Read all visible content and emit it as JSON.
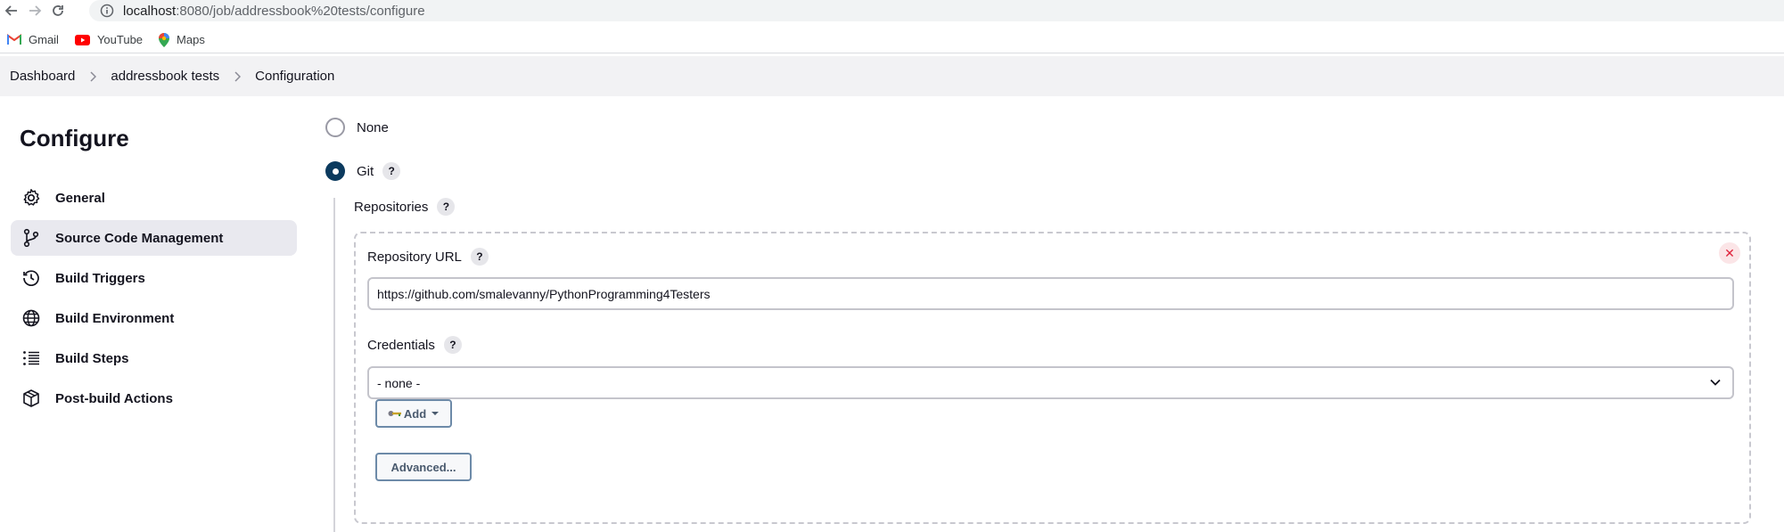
{
  "browser": {
    "url_host": "localhost",
    "url_path": ":8080/job/addressbook%20tests/configure",
    "bookmarks": [
      {
        "label": "Gmail",
        "icon": "gmail-icon"
      },
      {
        "label": "YouTube",
        "icon": "youtube-icon"
      },
      {
        "label": "Maps",
        "icon": "maps-icon"
      }
    ]
  },
  "breadcrumbs": [
    "Dashboard",
    "addressbook tests",
    "Configuration"
  ],
  "sidebar": {
    "title": "Configure",
    "items": [
      {
        "label": "General",
        "icon": "gear-icon"
      },
      {
        "label": "Source Code Management",
        "icon": "branch-icon",
        "active": true
      },
      {
        "label": "Build Triggers",
        "icon": "clock-icon"
      },
      {
        "label": "Build Environment",
        "icon": "globe-icon"
      },
      {
        "label": "Build Steps",
        "icon": "list-icon"
      },
      {
        "label": "Post-build Actions",
        "icon": "package-icon"
      }
    ]
  },
  "scm": {
    "options": [
      {
        "label": "None",
        "checked": false
      },
      {
        "label": "Git",
        "checked": true
      }
    ],
    "repositories_label": "Repositories",
    "repo_url_label": "Repository URL",
    "repo_url_value": "https://github.com/smalevanny/PythonProgramming4Testers",
    "credentials_label": "Credentials",
    "credentials_value": "- none -",
    "add_label": "Add",
    "advanced_label": "Advanced...",
    "help_glyph": "?",
    "close_glyph": "✕"
  },
  "colors": {
    "accent": "#0b3a5e",
    "active_bg": "#e9e9ef",
    "danger": "#e0243c"
  }
}
